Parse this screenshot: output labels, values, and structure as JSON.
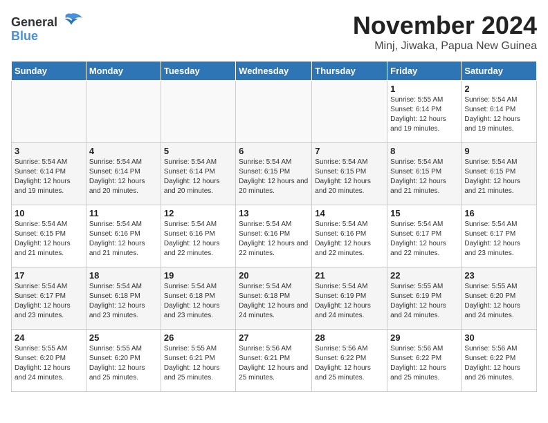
{
  "header": {
    "logo_general": "General",
    "logo_blue": "Blue",
    "month": "November 2024",
    "location": "Minj, Jiwaka, Papua New Guinea"
  },
  "weekdays": [
    "Sunday",
    "Monday",
    "Tuesday",
    "Wednesday",
    "Thursday",
    "Friday",
    "Saturday"
  ],
  "weeks": [
    [
      {
        "day": "",
        "info": ""
      },
      {
        "day": "",
        "info": ""
      },
      {
        "day": "",
        "info": ""
      },
      {
        "day": "",
        "info": ""
      },
      {
        "day": "",
        "info": ""
      },
      {
        "day": "1",
        "info": "Sunrise: 5:55 AM\nSunset: 6:14 PM\nDaylight: 12 hours and 19 minutes."
      },
      {
        "day": "2",
        "info": "Sunrise: 5:54 AM\nSunset: 6:14 PM\nDaylight: 12 hours and 19 minutes."
      }
    ],
    [
      {
        "day": "3",
        "info": "Sunrise: 5:54 AM\nSunset: 6:14 PM\nDaylight: 12 hours and 19 minutes."
      },
      {
        "day": "4",
        "info": "Sunrise: 5:54 AM\nSunset: 6:14 PM\nDaylight: 12 hours and 20 minutes."
      },
      {
        "day": "5",
        "info": "Sunrise: 5:54 AM\nSunset: 6:14 PM\nDaylight: 12 hours and 20 minutes."
      },
      {
        "day": "6",
        "info": "Sunrise: 5:54 AM\nSunset: 6:15 PM\nDaylight: 12 hours and 20 minutes."
      },
      {
        "day": "7",
        "info": "Sunrise: 5:54 AM\nSunset: 6:15 PM\nDaylight: 12 hours and 20 minutes."
      },
      {
        "day": "8",
        "info": "Sunrise: 5:54 AM\nSunset: 6:15 PM\nDaylight: 12 hours and 21 minutes."
      },
      {
        "day": "9",
        "info": "Sunrise: 5:54 AM\nSunset: 6:15 PM\nDaylight: 12 hours and 21 minutes."
      }
    ],
    [
      {
        "day": "10",
        "info": "Sunrise: 5:54 AM\nSunset: 6:15 PM\nDaylight: 12 hours and 21 minutes."
      },
      {
        "day": "11",
        "info": "Sunrise: 5:54 AM\nSunset: 6:16 PM\nDaylight: 12 hours and 21 minutes."
      },
      {
        "day": "12",
        "info": "Sunrise: 5:54 AM\nSunset: 6:16 PM\nDaylight: 12 hours and 22 minutes."
      },
      {
        "day": "13",
        "info": "Sunrise: 5:54 AM\nSunset: 6:16 PM\nDaylight: 12 hours and 22 minutes."
      },
      {
        "day": "14",
        "info": "Sunrise: 5:54 AM\nSunset: 6:16 PM\nDaylight: 12 hours and 22 minutes."
      },
      {
        "day": "15",
        "info": "Sunrise: 5:54 AM\nSunset: 6:17 PM\nDaylight: 12 hours and 22 minutes."
      },
      {
        "day": "16",
        "info": "Sunrise: 5:54 AM\nSunset: 6:17 PM\nDaylight: 12 hours and 23 minutes."
      }
    ],
    [
      {
        "day": "17",
        "info": "Sunrise: 5:54 AM\nSunset: 6:17 PM\nDaylight: 12 hours and 23 minutes."
      },
      {
        "day": "18",
        "info": "Sunrise: 5:54 AM\nSunset: 6:18 PM\nDaylight: 12 hours and 23 minutes."
      },
      {
        "day": "19",
        "info": "Sunrise: 5:54 AM\nSunset: 6:18 PM\nDaylight: 12 hours and 23 minutes."
      },
      {
        "day": "20",
        "info": "Sunrise: 5:54 AM\nSunset: 6:18 PM\nDaylight: 12 hours and 24 minutes."
      },
      {
        "day": "21",
        "info": "Sunrise: 5:54 AM\nSunset: 6:19 PM\nDaylight: 12 hours and 24 minutes."
      },
      {
        "day": "22",
        "info": "Sunrise: 5:55 AM\nSunset: 6:19 PM\nDaylight: 12 hours and 24 minutes."
      },
      {
        "day": "23",
        "info": "Sunrise: 5:55 AM\nSunset: 6:20 PM\nDaylight: 12 hours and 24 minutes."
      }
    ],
    [
      {
        "day": "24",
        "info": "Sunrise: 5:55 AM\nSunset: 6:20 PM\nDaylight: 12 hours and 24 minutes."
      },
      {
        "day": "25",
        "info": "Sunrise: 5:55 AM\nSunset: 6:20 PM\nDaylight: 12 hours and 25 minutes."
      },
      {
        "day": "26",
        "info": "Sunrise: 5:55 AM\nSunset: 6:21 PM\nDaylight: 12 hours and 25 minutes."
      },
      {
        "day": "27",
        "info": "Sunrise: 5:56 AM\nSunset: 6:21 PM\nDaylight: 12 hours and 25 minutes."
      },
      {
        "day": "28",
        "info": "Sunrise: 5:56 AM\nSunset: 6:22 PM\nDaylight: 12 hours and 25 minutes."
      },
      {
        "day": "29",
        "info": "Sunrise: 5:56 AM\nSunset: 6:22 PM\nDaylight: 12 hours and 25 minutes."
      },
      {
        "day": "30",
        "info": "Sunrise: 5:56 AM\nSunset: 6:22 PM\nDaylight: 12 hours and 26 minutes."
      }
    ]
  ]
}
